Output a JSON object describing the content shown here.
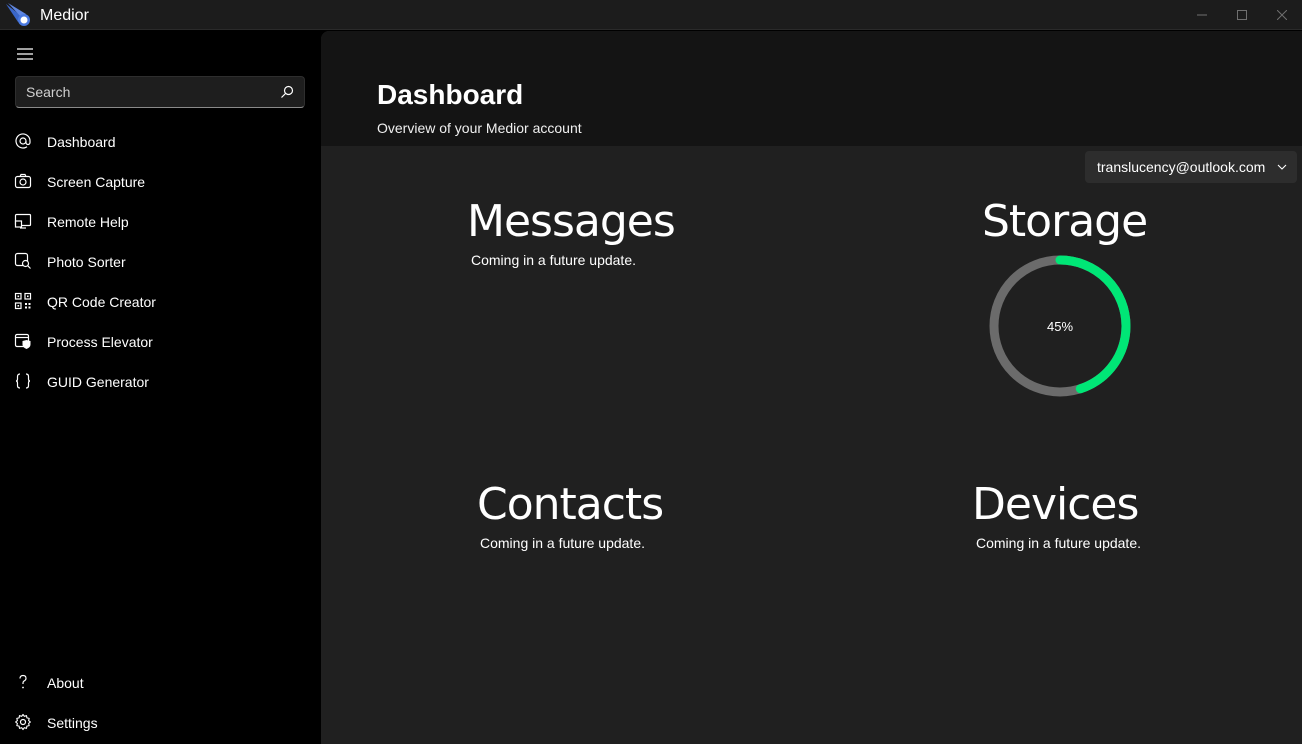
{
  "window": {
    "title": "Medior",
    "controls": [
      "minimize-icon",
      "maximize-icon",
      "close-icon"
    ]
  },
  "sidebar": {
    "search_placeholder": "Search",
    "items": [
      {
        "label": "Dashboard",
        "icon": "at-icon"
      },
      {
        "label": "Screen Capture",
        "icon": "camera-icon"
      },
      {
        "label": "Remote Help",
        "icon": "remote-icon"
      },
      {
        "label": "Photo Sorter",
        "icon": "photo-search-icon"
      },
      {
        "label": "QR Code Creator",
        "icon": "qr-code-icon"
      },
      {
        "label": "Process Elevator",
        "icon": "shield-window-icon"
      },
      {
        "label": "GUID Generator",
        "icon": "braces-icon"
      }
    ],
    "footer_items": [
      {
        "label": "About",
        "icon": "question-icon"
      },
      {
        "label": "Settings",
        "icon": "gear-icon"
      }
    ]
  },
  "header": {
    "title": "Dashboard",
    "subtitle": "Overview of your Medior account"
  },
  "account": {
    "selected": "translucency@outlook.com"
  },
  "cards": {
    "messages": {
      "title": "Messages",
      "subtitle": "Coming in a future update."
    },
    "storage": {
      "title": "Storage",
      "percent_label": "45%",
      "percent": 45
    },
    "contacts": {
      "title": "Contacts",
      "subtitle": "Coming in a future update."
    },
    "devices": {
      "title": "Devices",
      "subtitle": "Coming in a future update."
    }
  },
  "colors": {
    "accent": "#00e676",
    "ring_track": "#6b6b6b",
    "sidebar_bg": "#000000",
    "content_bg": "#202020",
    "header_bg": "#141414"
  }
}
